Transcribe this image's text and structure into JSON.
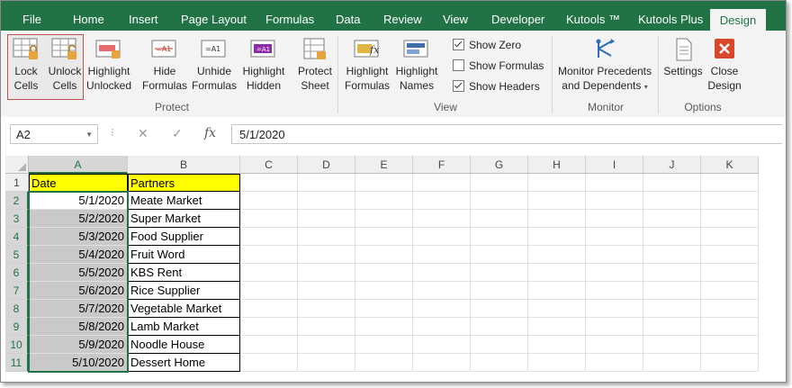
{
  "tabs": [
    {
      "label": "File"
    },
    {
      "label": "Home"
    },
    {
      "label": "Insert"
    },
    {
      "label": "Page Layout"
    },
    {
      "label": "Formulas"
    },
    {
      "label": "Data"
    },
    {
      "label": "Review"
    },
    {
      "label": "View"
    },
    {
      "label": "Developer"
    },
    {
      "label": "Kutools ™"
    },
    {
      "label": "Kutools Plus"
    },
    {
      "label": "Design"
    }
  ],
  "ribbon": {
    "protect": {
      "lock_l1": "Lock",
      "lock_l2": "Cells",
      "unlock_l1": "Unlock",
      "unlock_l2": "Cells",
      "hlu_l1": "Highlight",
      "hlu_l2": "Unlocked",
      "hide_l1": "Hide",
      "hide_l2": "Formulas",
      "unhide_l1": "Unhide",
      "unhide_l2": "Formulas",
      "hlh_l1": "Highlight",
      "hlh_l2": "Hidden",
      "ps_l1": "Protect",
      "ps_l2": "Sheet",
      "label": "Protect"
    },
    "view": {
      "hlf_l1": "Highlight",
      "hlf_l2": "Formulas",
      "hln_l1": "Highlight",
      "hln_l2": "Names",
      "show_zero": "Show Zero",
      "show_formulas": "Show Formulas",
      "show_headers": "Show Headers",
      "label": "View"
    },
    "monitor": {
      "l1": "Monitor Precedents",
      "l2": "and Dependents",
      "label": "Monitor"
    },
    "options": {
      "settings": "Settings",
      "close_l1": "Close",
      "close_l2": "Design",
      "label": "Options"
    }
  },
  "formula_bar": {
    "name_box": "A2",
    "formula": "5/1/2020",
    "fx": "fx"
  },
  "grid": {
    "columns": [
      "A",
      "B",
      "C",
      "D",
      "E",
      "F",
      "G",
      "H",
      "I",
      "J",
      "K"
    ],
    "rows": [
      "1",
      "2",
      "3",
      "4",
      "5",
      "6",
      "7",
      "8",
      "9",
      "10",
      "11"
    ],
    "header_a": "Date",
    "header_b": "Partners",
    "dates": [
      "5/1/2020",
      "5/2/2020",
      "5/3/2020",
      "5/4/2020",
      "5/5/2020",
      "5/6/2020",
      "5/7/2020",
      "5/8/2020",
      "5/9/2020",
      "5/10/2020"
    ],
    "partners": [
      "Meate Market",
      "Super Market",
      "Food Supplier",
      "Fruit Word",
      "KBS Rent",
      "Rice Supplier",
      "Vegetable Market",
      "Lamb Market",
      "Noodle House",
      "Dessert Home"
    ]
  },
  "colors": {
    "excel_green": "#217346",
    "header_fill": "#ffff00",
    "locked_fill": "#c9c9c9"
  }
}
